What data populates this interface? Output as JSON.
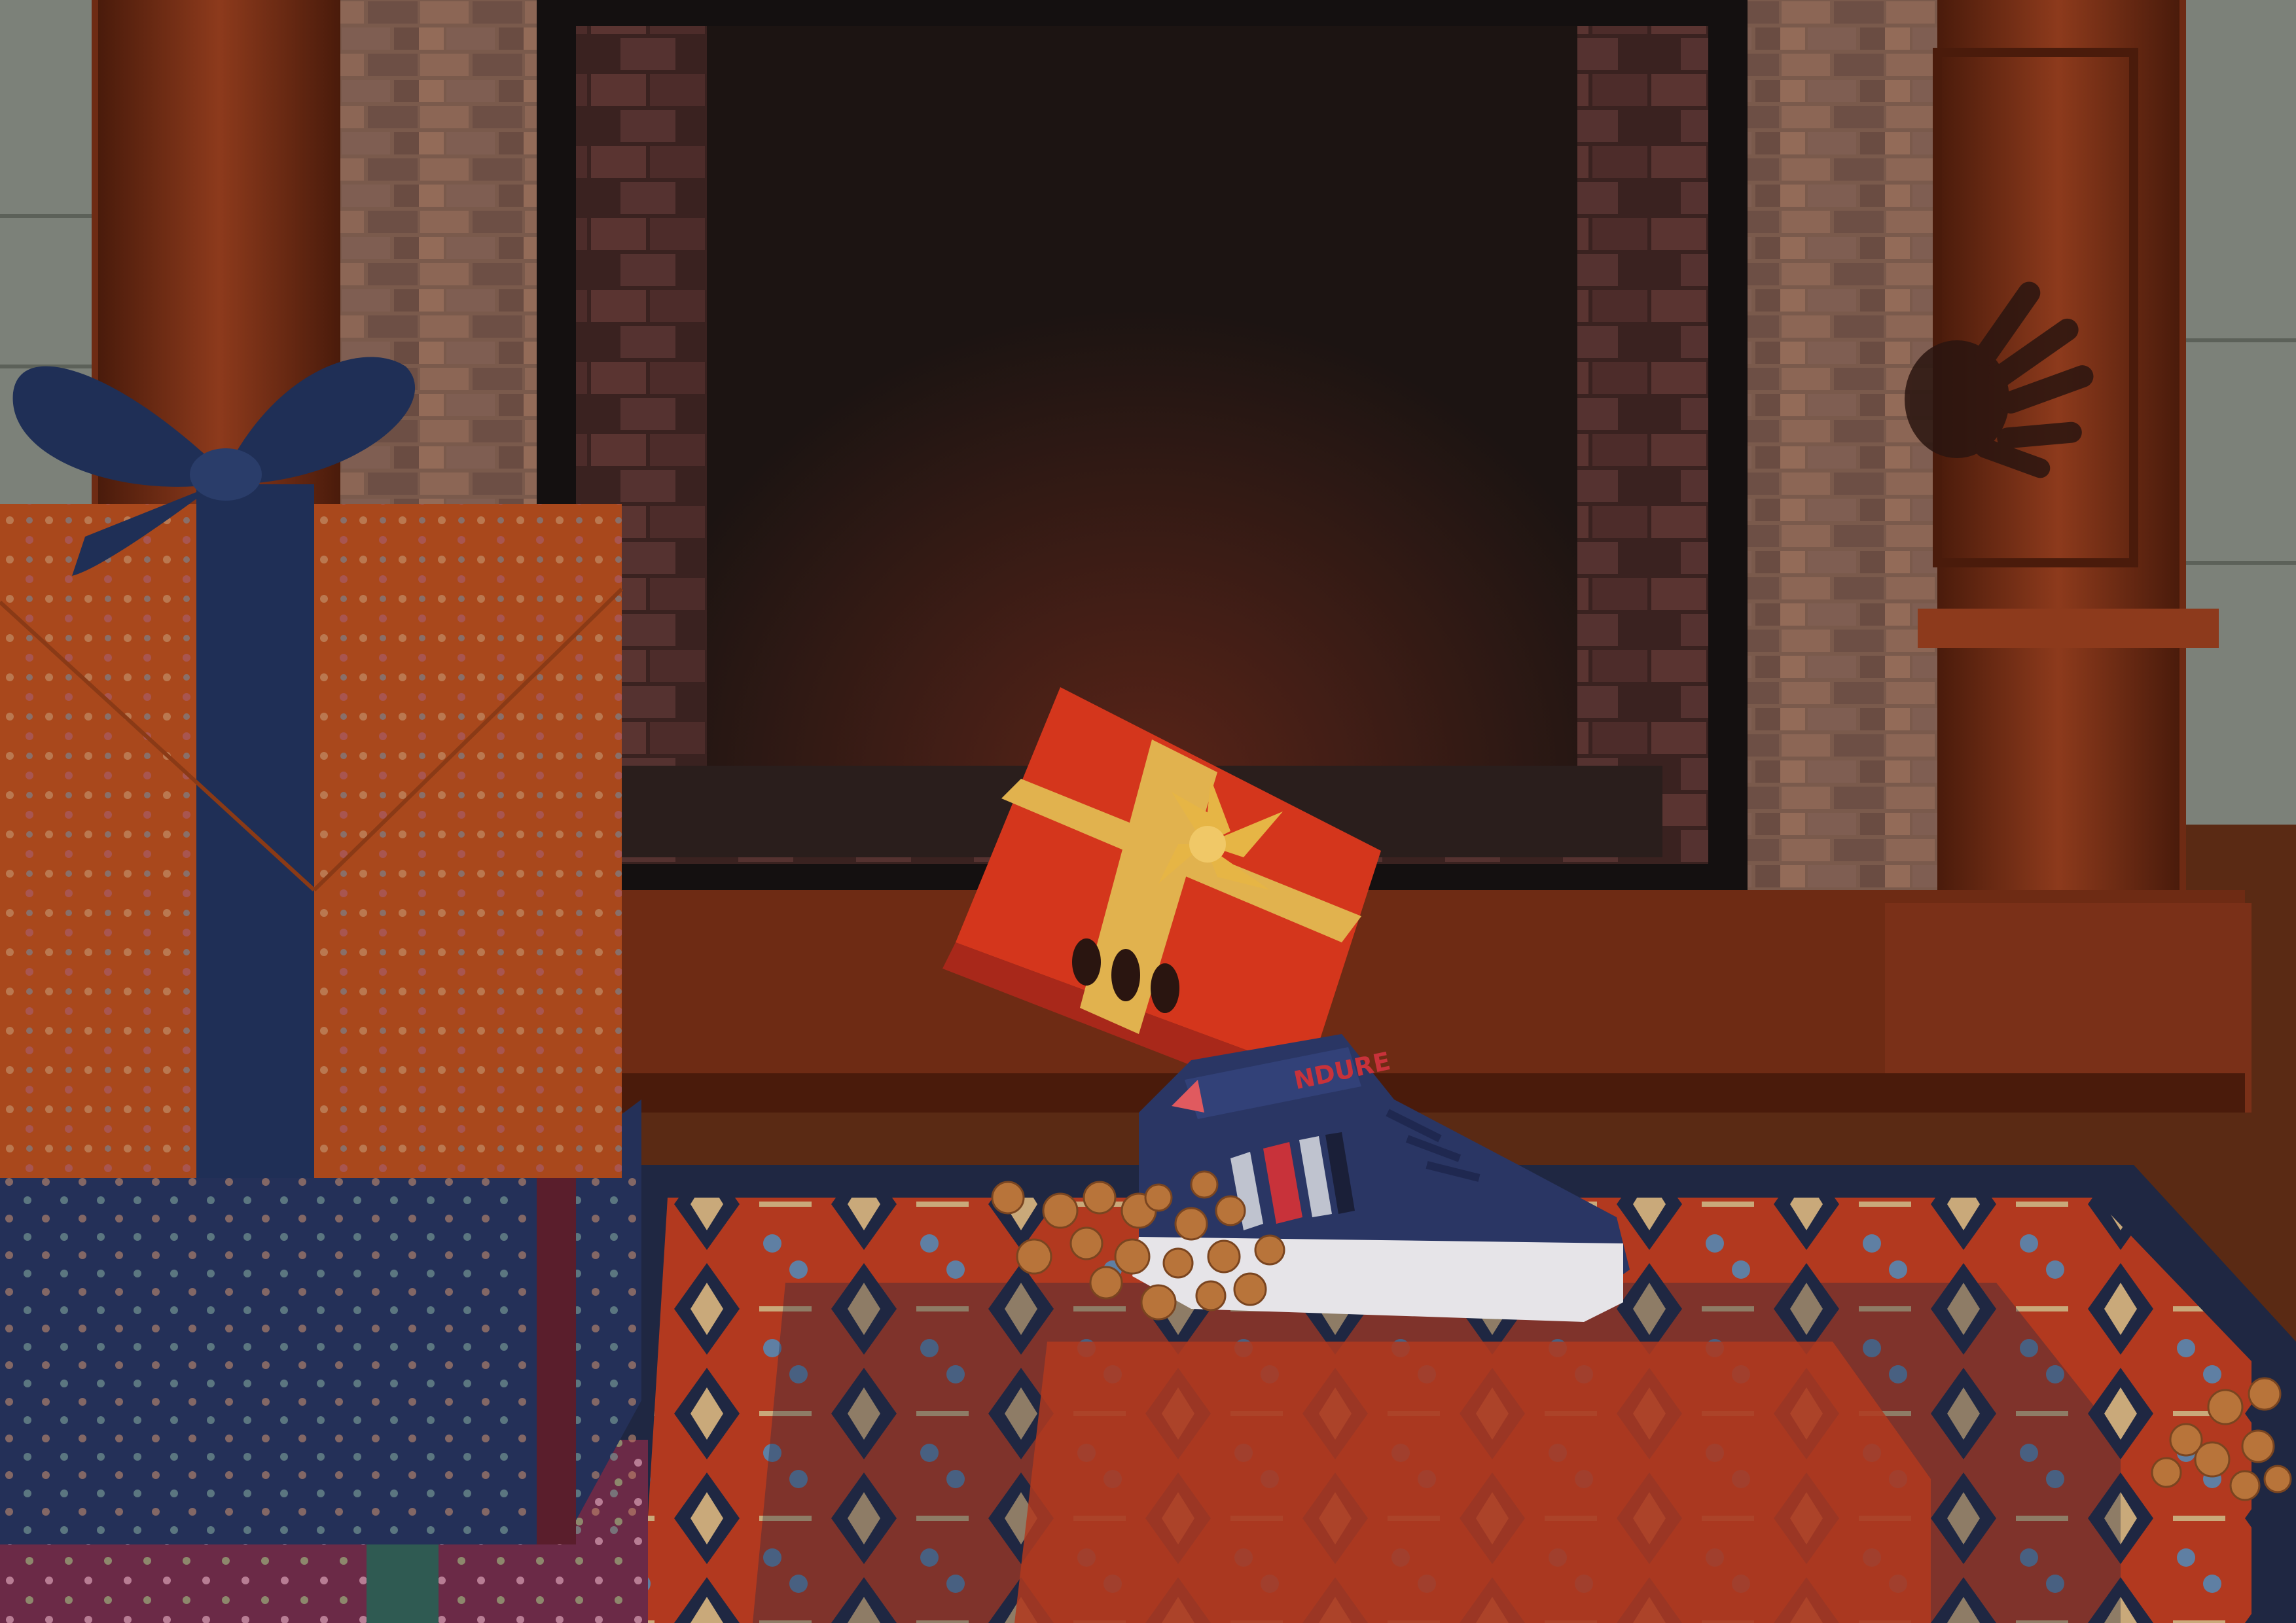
{
  "scene": {
    "shoe_brand_text": "NDURE"
  },
  "colors": {
    "wall": "#8a8f86",
    "wall_dark": "#6f756d",
    "wood": "#6e2b14",
    "wood_light": "#8d3a1c",
    "wood_dark": "#4a1b0b",
    "stone": "#7a5a4c",
    "firebox": "#1c1412",
    "floor": "#5a2a14",
    "rug_red": "#b2391f",
    "rug_navy": "#1f2742",
    "rug_blue": "#5f7fa3",
    "rug_cream": "#c9a97a",
    "gift_orange": "#a9481c",
    "gift_navy": "#243058",
    "gift_magenta": "#6b2a47",
    "ribbon_navy": "#1f2f56",
    "gift_red": "#d4361c",
    "ribbon_gold": "#e1b24e",
    "shoe_navy": "#2a3664",
    "shoe_red": "#c8323a",
    "sole_white": "#e6e4e8",
    "cookie": "#b8743a"
  }
}
